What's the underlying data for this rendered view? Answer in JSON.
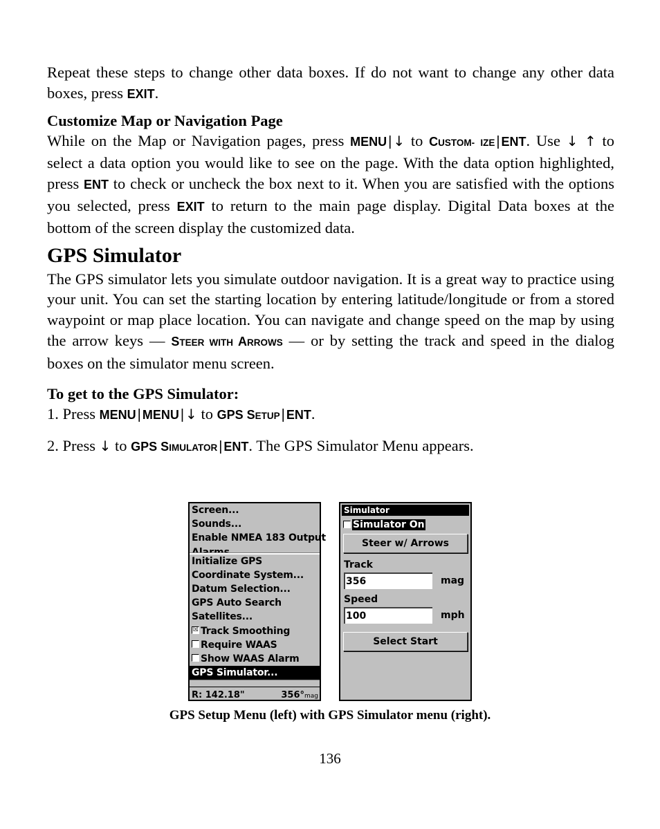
{
  "intro": {
    "text_before": "Repeat these steps to change other data boxes. If do not want to change any other data boxes, press ",
    "key_exit": "EXIT",
    "text_after": "."
  },
  "customize": {
    "heading": "Customize Map or Navigation Page",
    "t1": "While on the Map or Navigation pages, press ",
    "k_menu": "MENU",
    "bar": "|",
    "arrow_down": "↓",
    "t2": " to ",
    "sc_custom_big": "C",
    "sc_custom_small": "USTOM-",
    "sc_ize_small": "IZE",
    "k_ent": "ENT",
    "t3": ". Use ",
    "arrows_ud": "↓ ↑",
    "t4": " to select a data option you would like to see on the page. With the data option highlighted, press ",
    "t5": " to check or uncheck the box next to it. When you are satisfied with the options you selected, press ",
    "k_exit": "EXIT",
    "t6": " to return to the main page display. Digital Data boxes at the bottom of the screen display the customized data."
  },
  "gps_sim": {
    "heading": "GPS Simulator",
    "t1": "The GPS simulator lets you simulate outdoor navigation. It is a great way to practice using your unit. You can set the starting location by entering latitude/longitude or from a stored waypoint or map place location. You can navigate and change speed on the map by using the arrow keys — ",
    "sc_s": "S",
    "sc_teer_with": "TEER WITH ",
    "sc_a": "A",
    "sc_rrows": "RROWS",
    "t2": " — or by setting the track and speed in the dialog boxes on the simulator menu screen."
  },
  "steps": {
    "heading": "To get to the GPS Simulator:",
    "step1": {
      "prefix": "1. Press ",
      "k_menu": "MENU",
      "t_to": " to ",
      "sc_gps": "GPS S",
      "sc_etup": "ETUP",
      "k_ent": "ENT",
      "end": "."
    },
    "step2": {
      "prefix": "2. Press ",
      "t_to": " to ",
      "sc_gps": "GPS S",
      "sc_imulator": "IMULATOR",
      "k_ent": "ENT",
      "end": ". The GPS Simulator Menu appears."
    }
  },
  "gps_setup_menu": {
    "items_top": [
      "Screen...",
      "Sounds...",
      "Enable NMEA 183 Output"
    ],
    "item_cut": "Alarms...",
    "items": [
      {
        "label": "Initialize GPS"
      },
      {
        "label": "Coordinate System..."
      },
      {
        "label": "Datum Selection..."
      },
      {
        "label": "GPS Auto Search"
      },
      {
        "label": "Satellites..."
      },
      {
        "label": "Track Smoothing",
        "checkbox": true,
        "checked": true,
        "check_glyph": "☒"
      },
      {
        "label": "Require WAAS",
        "checkbox": true,
        "checked": false
      },
      {
        "label": "Show WAAS Alarm",
        "checkbox": true,
        "checked": false
      },
      {
        "label": "GPS Simulator...",
        "selected": true
      }
    ],
    "status_left": "R:  142.18\"",
    "status_right": "356°",
    "status_right_unit": "mag"
  },
  "simulator_menu": {
    "title": "Simulator",
    "simulator_on_label": "Simulator On",
    "simulator_on_checked": false,
    "steer_button": "Steer w/ Arrows",
    "track_label": "Track",
    "track_value": "356",
    "track_unit": "mag",
    "speed_label": "Speed",
    "speed_value": "100",
    "speed_unit": "mph",
    "select_start_button": "Select Start"
  },
  "caption": "GPS Setup Menu (left) with GPS Simulator menu (right).",
  "page_number": "136"
}
